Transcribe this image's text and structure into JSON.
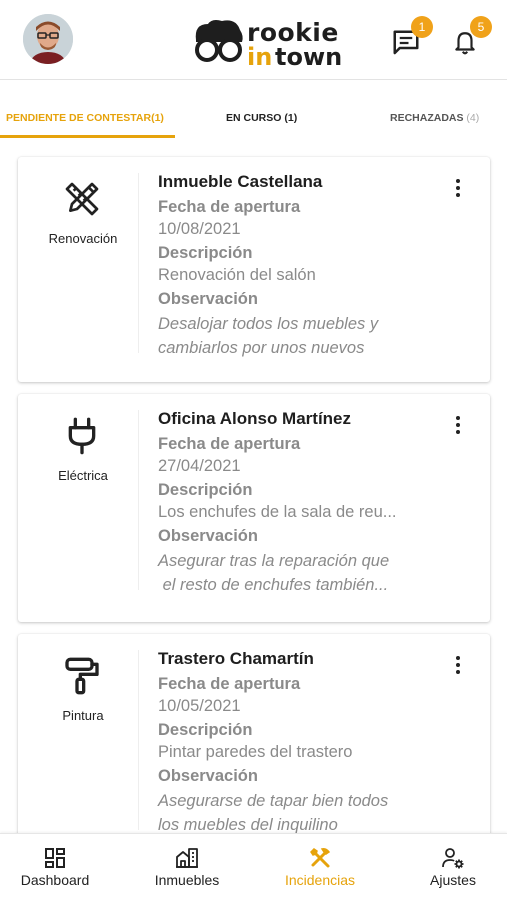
{
  "header": {
    "logo_line1": "rookie",
    "logo_line2a": "in",
    "logo_line2b": "town",
    "messages_badge": "1",
    "notifications_badge": "5"
  },
  "tabs": [
    {
      "label": "PENDIENTE DE CONTESTAR",
      "count": "(1)"
    },
    {
      "label": "EN CURSO",
      "count": "(1)"
    },
    {
      "label": "RECHAZADAS",
      "count": "(4)"
    }
  ],
  "field_labels": {
    "fecha": "Fecha de apertura",
    "descripcion": "Descripción",
    "observacion": "Observación"
  },
  "incidencias": [
    {
      "category": "Renovación",
      "icon": "ruler-pencil-icon",
      "title": "Inmueble Castellana",
      "fecha": "10/08/2021",
      "descripcion": "Renovación del salón",
      "observacion": "Desalojar todos los muebles y\ncambiarlos por unos nuevos"
    },
    {
      "category": "Eléctrica",
      "icon": "plug-icon",
      "title": "Oficina Alonso Martínez",
      "fecha": "27/04/2021",
      "descripcion": "Los enchufes de la sala de reu...",
      "observacion": "Asegurar tras la reparación que\n el resto de enchufes también..."
    },
    {
      "category": "Pintura",
      "icon": "paint-roller-icon",
      "title": "Trastero Chamartín",
      "fecha": "10/05/2021",
      "descripcion": "Pintar paredes del trastero",
      "observacion": "Asegurarse de tapar bien todos\nlos muebles del inquilino"
    }
  ],
  "bottom_nav": [
    {
      "label": "Dashboard",
      "icon": "dashboard-icon"
    },
    {
      "label": "Inmuebles",
      "icon": "building-icon"
    },
    {
      "label": "Incidencias",
      "icon": "tools-icon",
      "active": true
    },
    {
      "label": "Ajustes",
      "icon": "user-settings-icon"
    }
  ],
  "colors": {
    "accent": "#e6a30c",
    "badge": "#f0a21a",
    "muted_text": "#8a8a8a"
  }
}
